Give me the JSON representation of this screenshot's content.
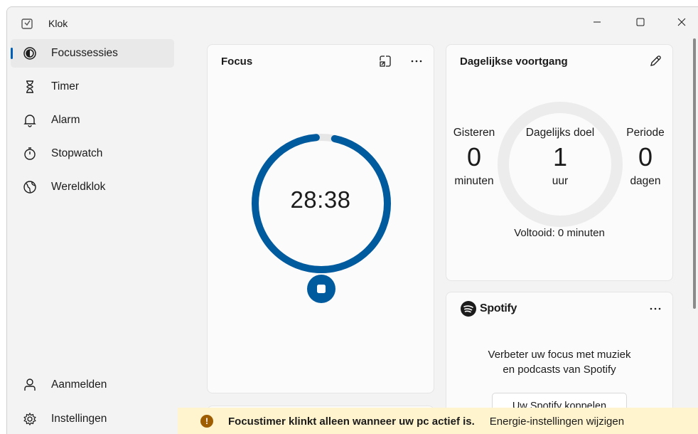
{
  "app": {
    "title": "Klok",
    "icon": "clock-app-icon"
  },
  "sidebar": {
    "items": [
      {
        "label": "Focussessies",
        "icon": "focus-icon",
        "active": true
      },
      {
        "label": "Timer",
        "icon": "hourglass-icon"
      },
      {
        "label": "Alarm",
        "icon": "bell-icon"
      },
      {
        "label": "Stopwatch",
        "icon": "stopwatch-icon"
      },
      {
        "label": "Wereldklok",
        "icon": "globe-icon"
      }
    ],
    "footer": [
      {
        "label": "Aanmelden",
        "icon": "person-icon"
      },
      {
        "label": "Instellingen",
        "icon": "gear-icon"
      }
    ]
  },
  "focus_card": {
    "title": "Focus",
    "time": "28:38",
    "progress": 0.955,
    "accent": "#005a9e"
  },
  "daily_card": {
    "title": "Dagelijkse voortgang",
    "yesterday": {
      "top": "Gisteren",
      "value": "0",
      "bottom": "minuten"
    },
    "goal": {
      "top": "Dagelijks doel",
      "value": "1",
      "bottom": "uur"
    },
    "streak": {
      "top": "Periode",
      "value": "0",
      "bottom": "dagen"
    },
    "completed": "Voltooid: 0 minuten"
  },
  "spotify_card": {
    "brand": "Spotify",
    "message_line1": "Verbeter uw focus met muziek",
    "message_line2": "en podcasts van Spotify",
    "connect_label": "Uw Spotify koppelen"
  },
  "notice": {
    "text": "Focustimer klinkt alleen wanneer uw pc actief is.",
    "link": "Energie-instellingen wijzigen",
    "color": "#fff4ce"
  }
}
